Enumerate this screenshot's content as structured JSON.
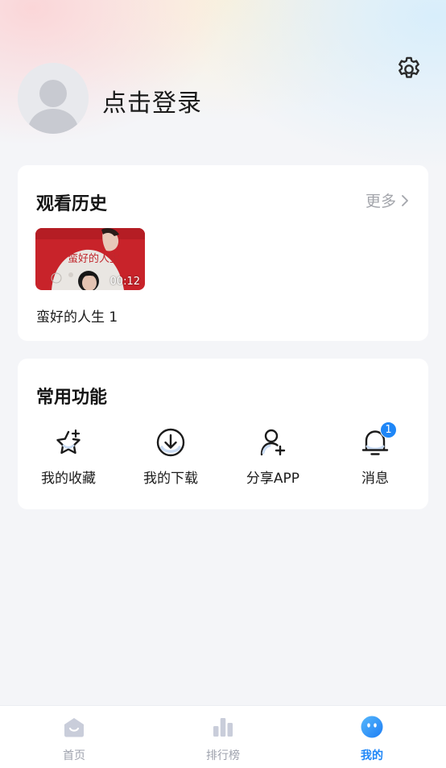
{
  "profile": {
    "login_text": "点击登录",
    "settings_icon": "gear-icon",
    "avatar_icon": "default-avatar"
  },
  "history": {
    "title": "观看历史",
    "more_label": "更多",
    "items": [
      {
        "title": "蛮好的人生 1",
        "duration": "00:12",
        "poster_text": "蛮好的人生"
      }
    ]
  },
  "features": {
    "title": "常用功能",
    "items": [
      {
        "label": "我的收藏",
        "icon": "star-icon"
      },
      {
        "label": "我的下载",
        "icon": "download-icon"
      },
      {
        "label": "分享APP",
        "icon": "share-user-icon"
      },
      {
        "label": "消息",
        "icon": "bell-icon",
        "badge": "1"
      }
    ]
  },
  "tabbar": {
    "tabs": [
      {
        "label": "首页",
        "icon": "home-icon",
        "active": false
      },
      {
        "label": "排行榜",
        "icon": "ranking-icon",
        "active": false
      },
      {
        "label": "我的",
        "icon": "profile-face-icon",
        "active": true
      }
    ]
  },
  "colors": {
    "accent": "#1e86f7",
    "inactive_tab": "#9ea2ad",
    "background": "#f4f5f8",
    "poster_red": "#c8232a"
  }
}
